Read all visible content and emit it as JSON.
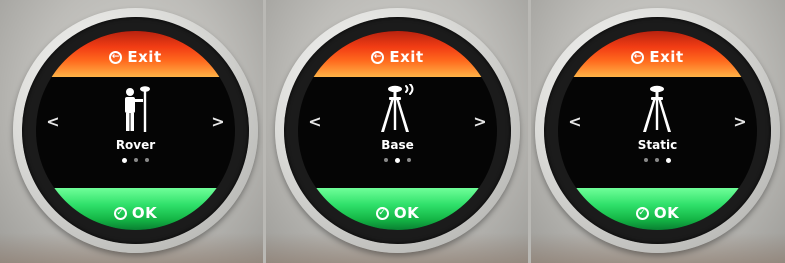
{
  "exit_label": "Exit",
  "ok_label": "OK",
  "prev_arrow": "<",
  "next_arrow": ">",
  "panels": [
    {
      "mode": "Rover",
      "icon": "rover-surveyor-icon",
      "page_active": 1,
      "page_count": 3
    },
    {
      "mode": "Base",
      "icon": "base-tripod-broadcast-icon",
      "page_active": 2,
      "page_count": 3
    },
    {
      "mode": "Static",
      "icon": "static-tripod-icon",
      "page_active": 3,
      "page_count": 3
    }
  ],
  "colors": {
    "exit_band": "#f23d14",
    "ok_band": "#2fe06a",
    "screen_bg": "#050505",
    "text": "#ffffff"
  }
}
